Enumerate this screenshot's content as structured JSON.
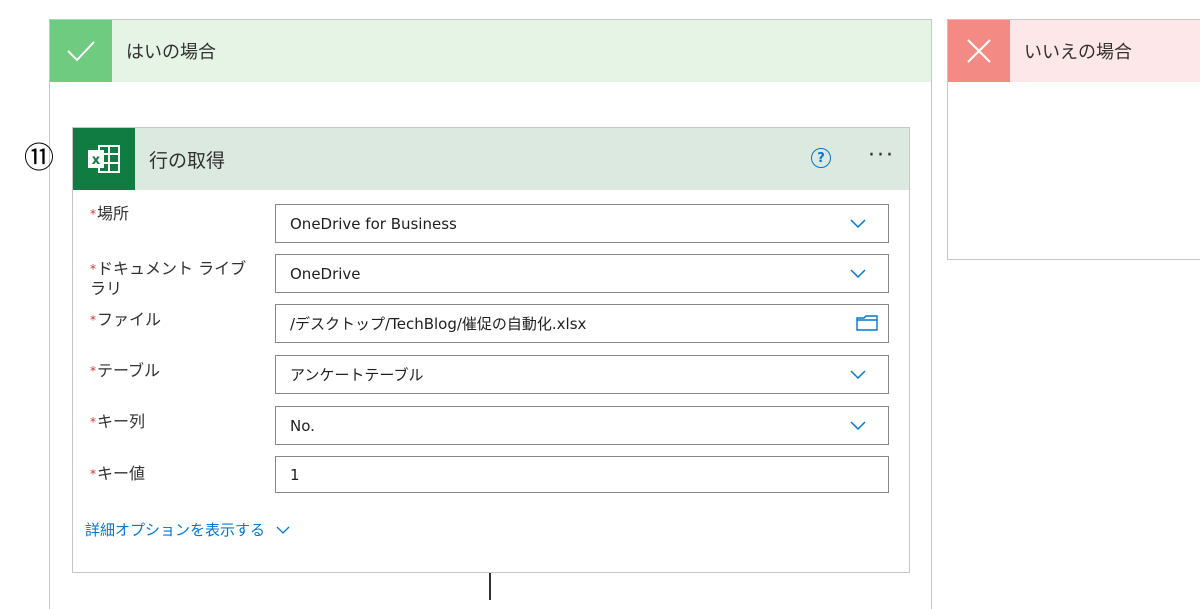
{
  "branch_yes": {
    "title": "はいの場合"
  },
  "branch_no": {
    "title": "いいえの場合"
  },
  "step": {
    "number": "⑪"
  },
  "action": {
    "title": "行の取得",
    "help_label": "?",
    "more_label": "···",
    "fields": [
      {
        "label": "場所",
        "value": "OneDrive for Business",
        "control": "dropdown"
      },
      {
        "label": "ドキュメント ライブラリ",
        "value": "OneDrive",
        "control": "dropdown"
      },
      {
        "label": "ファイル",
        "value": "/デスクトップ/TechBlog/催促の自動化.xlsx",
        "control": "file-picker"
      },
      {
        "label": "テーブル",
        "value": "アンケートテーブル",
        "control": "dropdown"
      },
      {
        "label": "キー列",
        "value": "No.",
        "control": "dropdown"
      },
      {
        "label": "キー値",
        "value": "1",
        "control": "text"
      }
    ],
    "required_mark": "*",
    "advanced_options_label": "詳細オプションを表示する"
  },
  "colors": {
    "yes_header": "#e5f4e5",
    "yes_icon": "#6fcb7f",
    "no_header": "#fde7e9",
    "no_icon": "#f38b84",
    "excel_green": "#107c41",
    "action_header": "#dbe9e0",
    "accent_blue": "#0078d4"
  }
}
